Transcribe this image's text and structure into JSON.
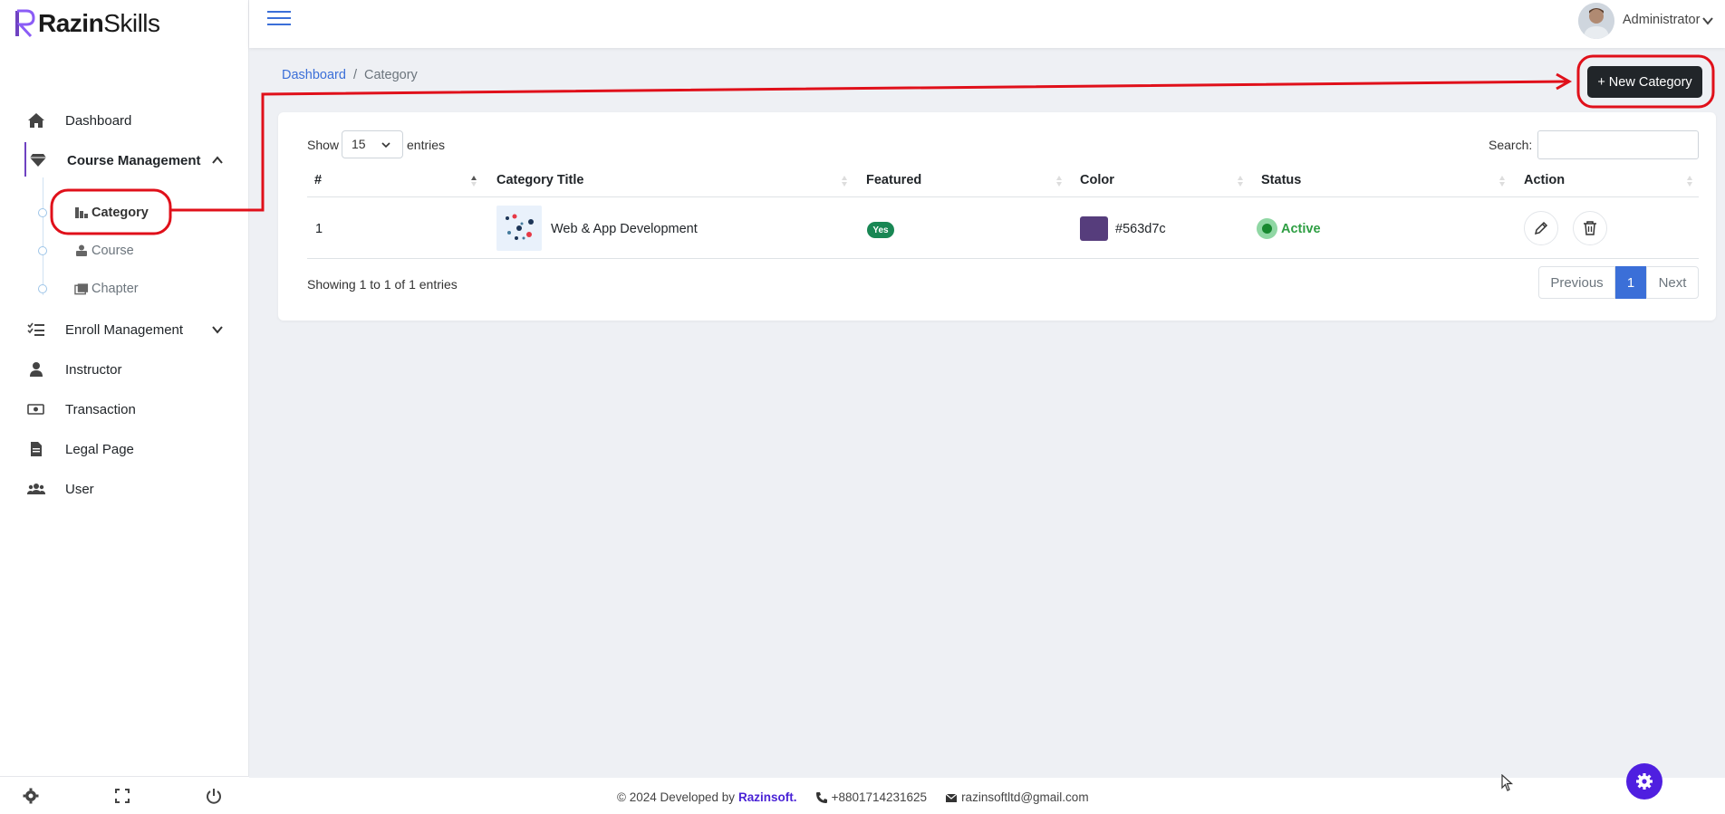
{
  "app": {
    "logo_part1": "Razin",
    "logo_part2": "Skills"
  },
  "sidebar": {
    "items": [
      {
        "label": "Dashboard",
        "icon": "home-icon"
      },
      {
        "label": "Course Management",
        "icon": "gem-icon"
      },
      {
        "label": "Enroll Management",
        "icon": "list-check-icon"
      },
      {
        "label": "Instructor",
        "icon": "user-tie-icon"
      },
      {
        "label": "Transaction",
        "icon": "money-icon"
      },
      {
        "label": "Legal Page",
        "icon": "file-icon"
      },
      {
        "label": "User",
        "icon": "users-icon"
      }
    ],
    "subitems": [
      {
        "label": "Category",
        "icon": "category-icon"
      },
      {
        "label": "Course",
        "icon": "course-icon"
      },
      {
        "label": "Chapter",
        "icon": "chapter-icon"
      }
    ]
  },
  "header": {
    "user_name": "Administrator"
  },
  "breadcrumb": {
    "home": "Dashboard",
    "separator": "/",
    "current": "Category"
  },
  "toolbar": {
    "new_label": "+ New Category"
  },
  "table": {
    "show_label": "Show",
    "page_size": "15",
    "entries_label": "entries",
    "search_label": "Search:",
    "search_value": "",
    "columns": [
      "#",
      "Category Title",
      "Featured",
      "Color",
      "Status",
      "Action"
    ],
    "rows": [
      {
        "index": "1",
        "title": "Web & App Development",
        "featured": "Yes",
        "color": "#563d7c",
        "status": "Active"
      }
    ],
    "info": "Showing 1 to 1 of 1 entries",
    "pagination": {
      "previous": "Previous",
      "current_page": "1",
      "next": "Next"
    }
  },
  "footer": {
    "copyright": "© 2024 Developed by",
    "brand": "Razinsoft.",
    "phone": "+8801714231625",
    "email": "razinsoftltd@gmail.com"
  },
  "colors": {
    "accent": "#3b6fd8",
    "brand_purple": "#4f1fe0",
    "annotation_red": "#e0101a"
  }
}
